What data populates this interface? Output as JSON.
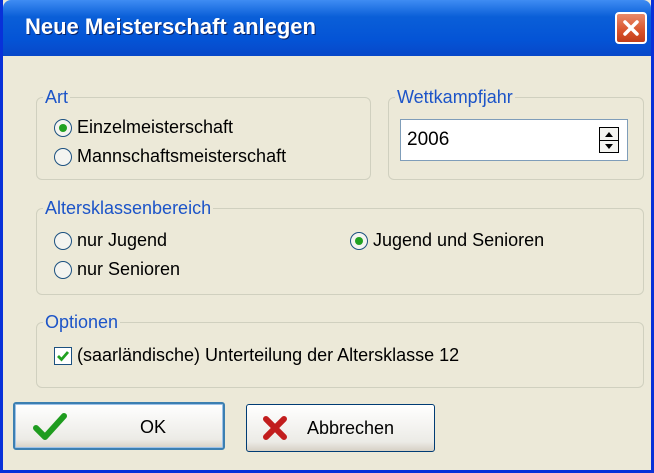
{
  "window": {
    "title": "Neue Meisterschaft anlegen"
  },
  "art": {
    "legend": "Art",
    "options": [
      "Einzelmeisterschaft",
      "Mannschaftsmeisterschaft"
    ],
    "selected": "Einzelmeisterschaft"
  },
  "wettkampfjahr": {
    "legend": "Wettkampfjahr",
    "value": "2006"
  },
  "altersklassen": {
    "legend": "Altersklassenbereich",
    "options": [
      "nur Jugend",
      "nur Senioren",
      "Jugend und Senioren"
    ],
    "selected": "Jugend und Senioren"
  },
  "optionen": {
    "legend": "Optionen",
    "checkbox_label": "(saarländische) Unterteilung der Altersklasse 12",
    "checked": true
  },
  "buttons": {
    "ok": "OK",
    "cancel": "Abbrechen"
  },
  "colors": {
    "title_bar": "#0454d6",
    "legend": "#1c54c8",
    "dialog_bg": "#ece9d8"
  }
}
